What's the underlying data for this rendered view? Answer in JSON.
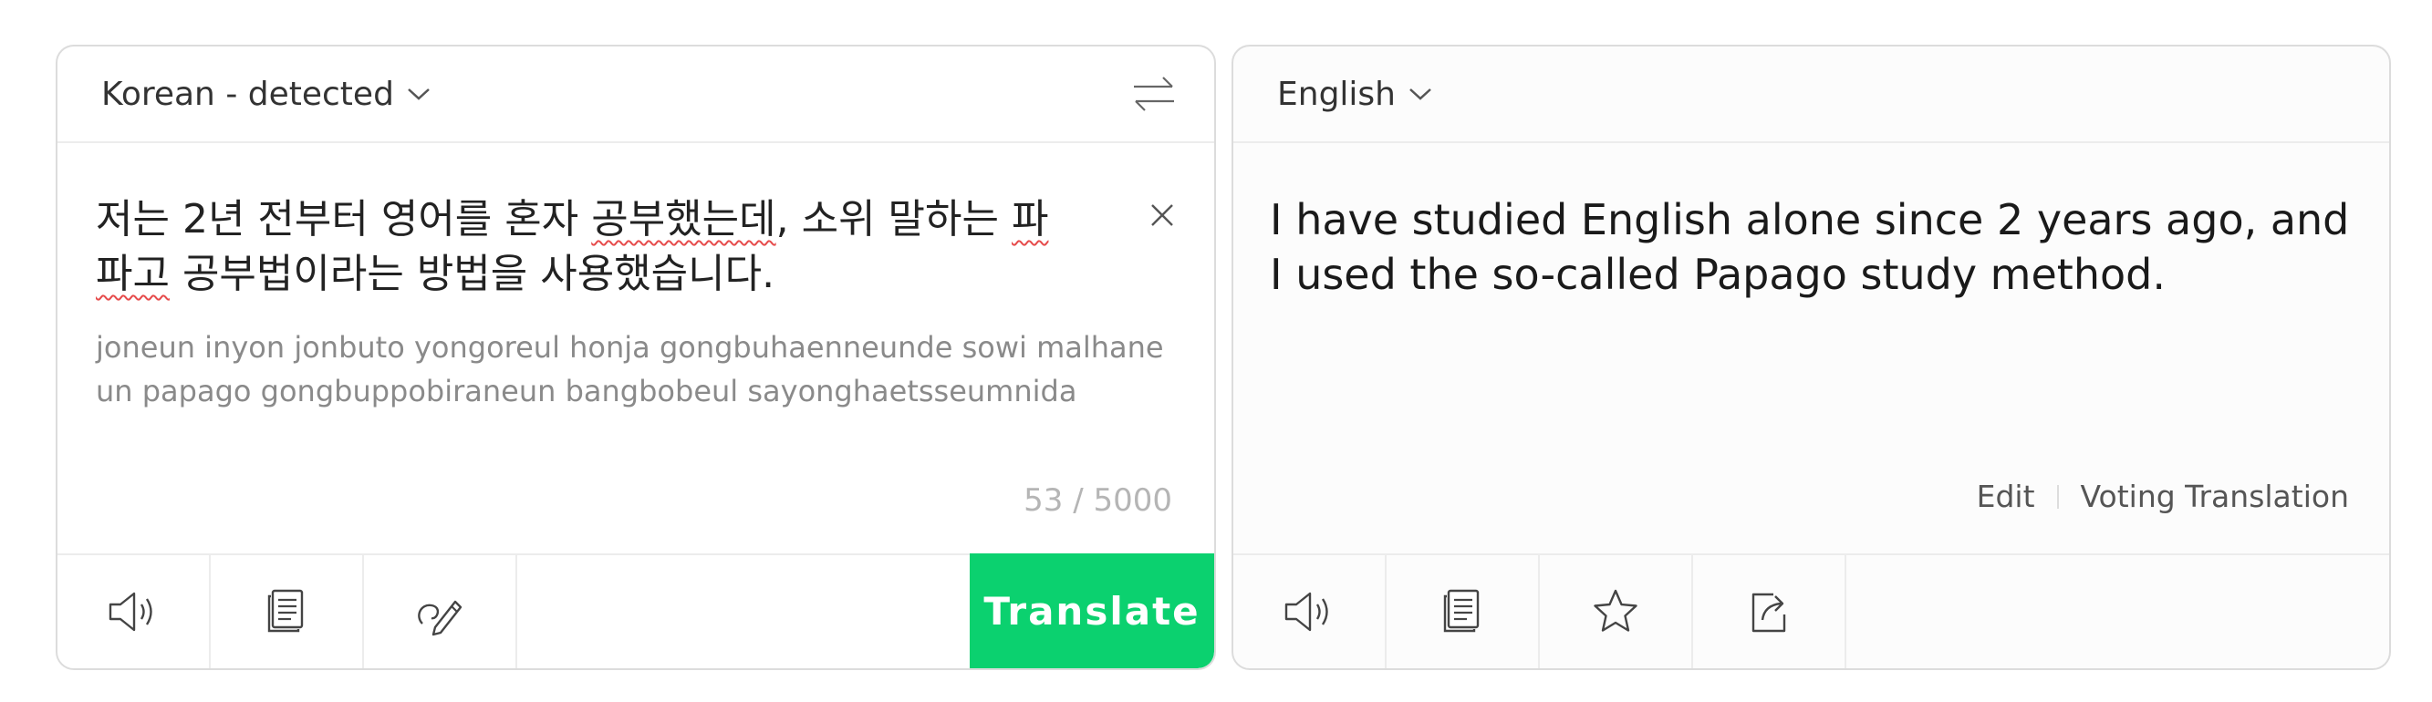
{
  "source": {
    "language": "Korean - detected",
    "text_line1_before": "저는 2년 전부터 영어를 혼자 ",
    "text_line1_misspelled": "공부했는데",
    "text_line1_after": ", 소위 말하는 ",
    "text_line1_end": "파",
    "text_line2_start": "파고",
    "text_line2_after": " 공부법이라는 방법을 사용했습니다.",
    "romanized": "joneun inyon jonbuto yongoreul honja gongbuhaenneunde sowi malhaneun papago gongbuppobiraneun bangbobeul sayonghaetsseumnida",
    "char_count": "53 / 5000",
    "translate_label": "Translate"
  },
  "target": {
    "language": "English",
    "text": "I have studied English alone since 2 years ago, and I used the so-called Papago study method.",
    "edit_label": "Edit",
    "voting_label": "Voting Translation"
  },
  "icons": {
    "source_tools": [
      "speaker-icon",
      "copy-icon",
      "handwriting-icon"
    ],
    "target_tools": [
      "speaker-icon",
      "copy-icon",
      "star-icon",
      "share-icon"
    ],
    "header": [
      "chevron-down-icon",
      "swap-icon",
      "close-icon"
    ]
  },
  "colors": {
    "translate_button": "#0bd16f",
    "spellcheck_underline": "#e64b4b",
    "romanized_text": "#8a8a8a",
    "counter_text": "#b5b5b5"
  }
}
